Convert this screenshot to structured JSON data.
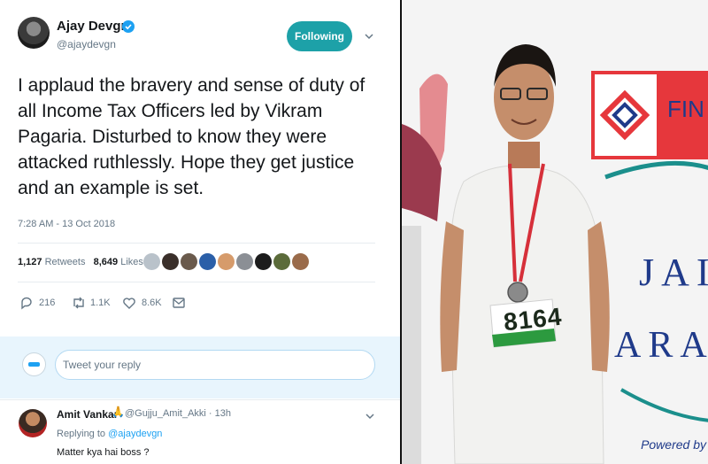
{
  "tweet": {
    "author_name": "Ajay Devgn",
    "author_handle": "@ajaydevgn",
    "follow_label": "Following",
    "text": "I applaud the bravery and sense of duty of all Income Tax Officers led by Vikram Pagaria. Disturbed to know they were attacked ruthlessly. Hope they get justice and an example is set.",
    "timestamp": "7:28 AM - 13 Oct 2018",
    "retweets_count": "1,127",
    "retweets_label": "Retweets",
    "likes_count": "8,649",
    "likes_label": "Likes",
    "actions": {
      "reply_count": "216",
      "retweet_count": "1.1K",
      "like_count": "8.6K"
    }
  },
  "reply_box": {
    "placeholder": "Tweet your reply"
  },
  "reply": {
    "name": "Amit Vankar",
    "emoji": "🙏",
    "handle_time": "@Gujju_Amit_Akki · 13h",
    "replying_prefix": "Replying to",
    "replying_mention": "@ajaydevgn",
    "text": "Matter kya hai boss ?"
  },
  "photo": {
    "banner_fin": "FIN",
    "banner_jai": "JAI",
    "banner_arat": "ARAT",
    "bib_number": "8164",
    "powered_by": "Powered by"
  },
  "colors": {
    "follow_button": "#1da1a8",
    "link": "#1da1f2",
    "muted": "#657786",
    "banner_red": "#e23b3b",
    "banner_blue": "#1f3a8a"
  }
}
